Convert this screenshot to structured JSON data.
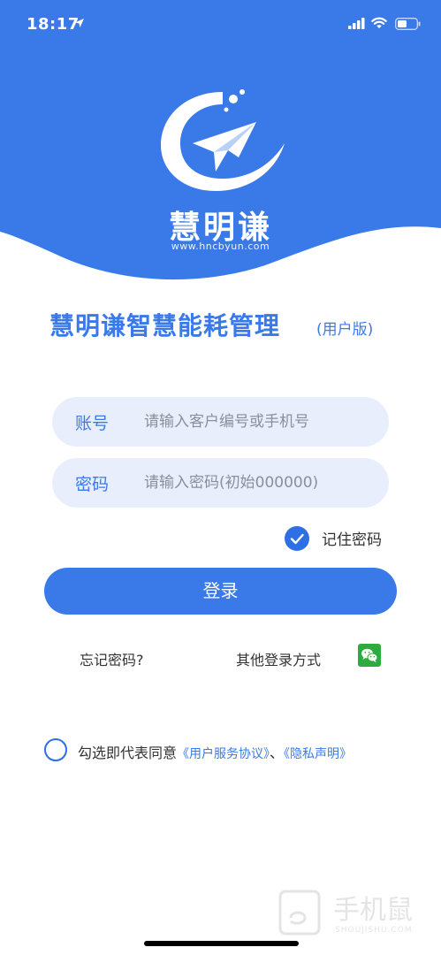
{
  "status_bar": {
    "time": "18:17"
  },
  "header": {
    "brand": "慧明谦",
    "url": "www.hncbyun.com"
  },
  "title": {
    "main": "慧明谦智慧能耗管理",
    "edition": "(用户版)"
  },
  "form": {
    "account_label": "账号",
    "account_placeholder": "请输入客户编号或手机号",
    "password_label": "密码",
    "password_placeholder": "请输入密码(初始000000)",
    "remember_label": "记住密码",
    "remember_checked": true,
    "login_label": "登录"
  },
  "links": {
    "forgot": "忘记密码?",
    "other_login": "其他登录方式"
  },
  "agreement": {
    "prefix": "勾选即代表同意",
    "service": "《用户服务协议》",
    "separator": "、",
    "privacy": "《隐私声明》"
  },
  "watermark": {
    "title": "手机鼠",
    "subtitle": "SHOUJISHU.COM"
  },
  "colors": {
    "primary": "#3a7ae8",
    "field_bg": "#e8eefc",
    "wechat": "#2dab3d"
  }
}
